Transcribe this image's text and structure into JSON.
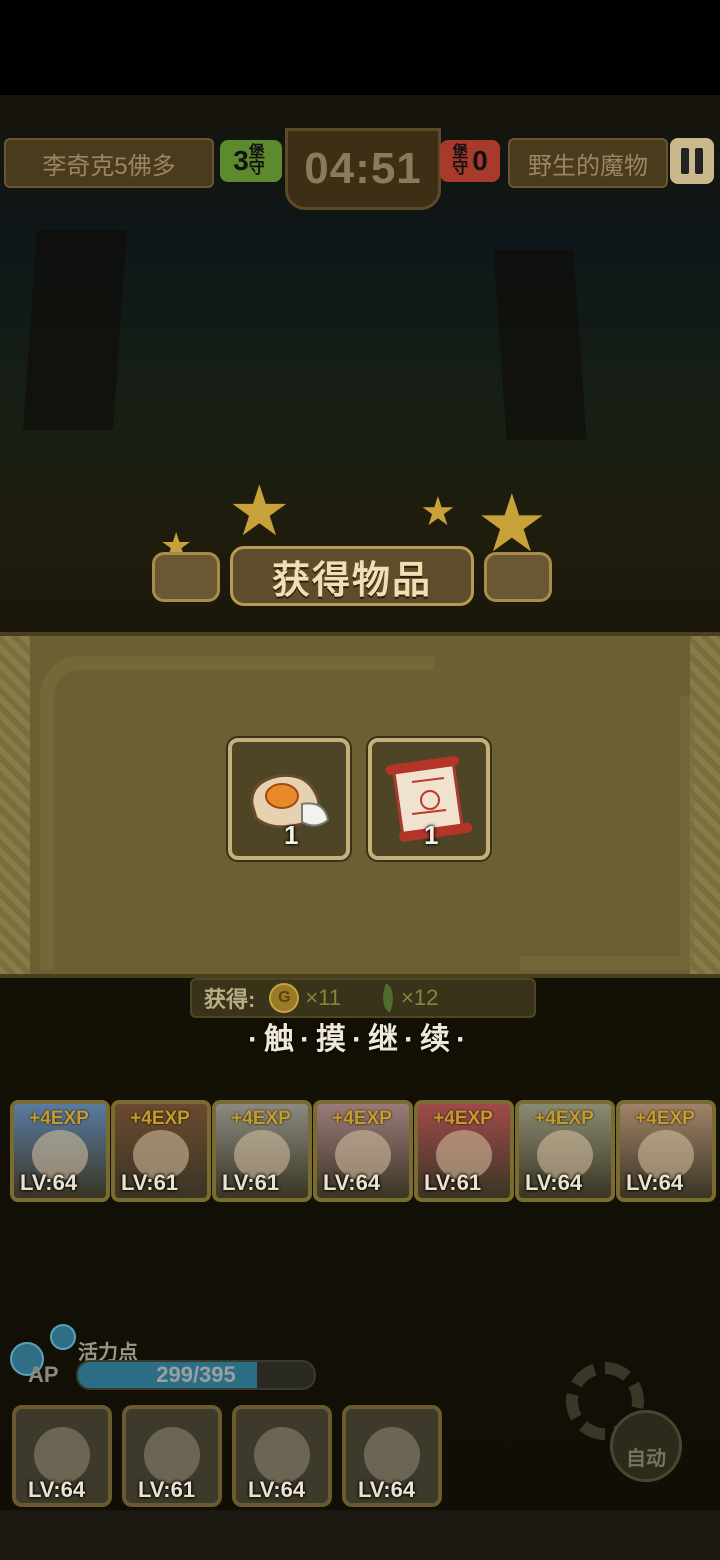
{
  "hud": {
    "left_player": "李奇克5佛多",
    "left_score": "3",
    "left_score_label": "堡守",
    "timer": "04:51",
    "right_score_label": "堡守",
    "right_score": "0",
    "right_player": "野生的魔物"
  },
  "reward": {
    "title": "获得物品",
    "items": [
      {
        "icon": "rice-sack-icon",
        "count": "1"
      },
      {
        "icon": "scroll-icon",
        "count": "1"
      }
    ],
    "gained_label": "获得:",
    "gold_qty": "×11",
    "leaf_qty": "×12",
    "continue_hint": "·触·摸·继·续·"
  },
  "party": [
    {
      "exp": "+4EXP",
      "level": "LV:64",
      "accent": "#5a7aa0"
    },
    {
      "exp": "+4EXP",
      "level": "LV:61",
      "accent": "#6a4a30"
    },
    {
      "exp": "+4EXP",
      "level": "LV:61",
      "accent": "#8a8a80"
    },
    {
      "exp": "+4EXP",
      "level": "LV:64",
      "accent": "#9a7a78"
    },
    {
      "exp": "+4EXP",
      "level": "LV:61",
      "accent": "#a04a4a"
    },
    {
      "exp": "+4EXP",
      "level": "LV:64",
      "accent": "#8a8a72"
    },
    {
      "exp": "+4EXP",
      "level": "LV:64",
      "accent": "#a08268"
    }
  ],
  "ap": {
    "label": "活力点",
    "tag": "AP",
    "text": "299/395",
    "current": 299,
    "max": 395
  },
  "team": [
    {
      "level": "LV:64"
    },
    {
      "level": "LV:61"
    },
    {
      "level": "LV:64"
    },
    {
      "level": "LV:64"
    }
  ],
  "auto_label": "自动"
}
